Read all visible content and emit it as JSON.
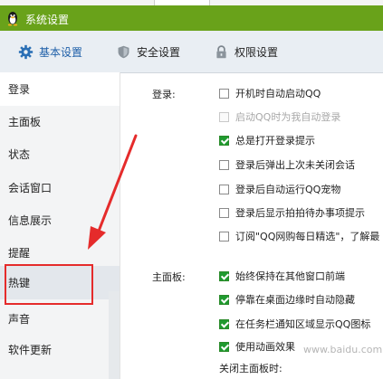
{
  "window": {
    "title": "系统设置"
  },
  "tabs": [
    {
      "label": "基本设置",
      "icon": "gear-icon"
    },
    {
      "label": "安全设置",
      "icon": "shield-icon"
    },
    {
      "label": "权限设置",
      "icon": "lock-icon"
    }
  ],
  "sidebar": {
    "items": [
      {
        "label": "登录"
      },
      {
        "label": "主面板"
      },
      {
        "label": "状态"
      },
      {
        "label": "会话窗口"
      },
      {
        "label": "信息展示"
      },
      {
        "label": "提醒"
      },
      {
        "label": "热键"
      },
      {
        "label": "声音"
      },
      {
        "label": "软件更新"
      }
    ]
  },
  "login_section": {
    "label": "登录:",
    "options": [
      {
        "label": "开机时自动启动QQ",
        "checked": false,
        "enabled": true
      },
      {
        "label": "启动QQ时为我自动登录",
        "checked": false,
        "enabled": false
      },
      {
        "label": "总是打开登录提示",
        "checked": true,
        "enabled": true
      },
      {
        "label": "登录后弹出上次未关闭会话",
        "checked": false,
        "enabled": true
      },
      {
        "label": "登录后自动运行QQ宠物",
        "checked": false,
        "enabled": true
      },
      {
        "label": "登录后显示拍拍待办事项提示",
        "checked": false,
        "enabled": true
      },
      {
        "label": "订阅\"QQ网购每日精选\"，了解最",
        "checked": false,
        "enabled": true
      }
    ]
  },
  "main_panel_section": {
    "label": "主面板:",
    "options": [
      {
        "label": "始终保持在其他窗口前端",
        "checked": true,
        "enabled": true
      },
      {
        "label": "停靠在桌面边缘时自动隐藏",
        "checked": true,
        "enabled": true
      },
      {
        "label": "在任务栏通知区域显示QQ图标",
        "checked": true,
        "enabled": true
      },
      {
        "label": "使用动画效果",
        "checked": true,
        "enabled": true
      }
    ],
    "close_label": "关闭主面板时:"
  },
  "watermark": "www.baidu.com",
  "colors": {
    "titlebar": "#69a21a",
    "annotation": "#e52b2b",
    "checkbox_checked": "#1f9a2f"
  }
}
